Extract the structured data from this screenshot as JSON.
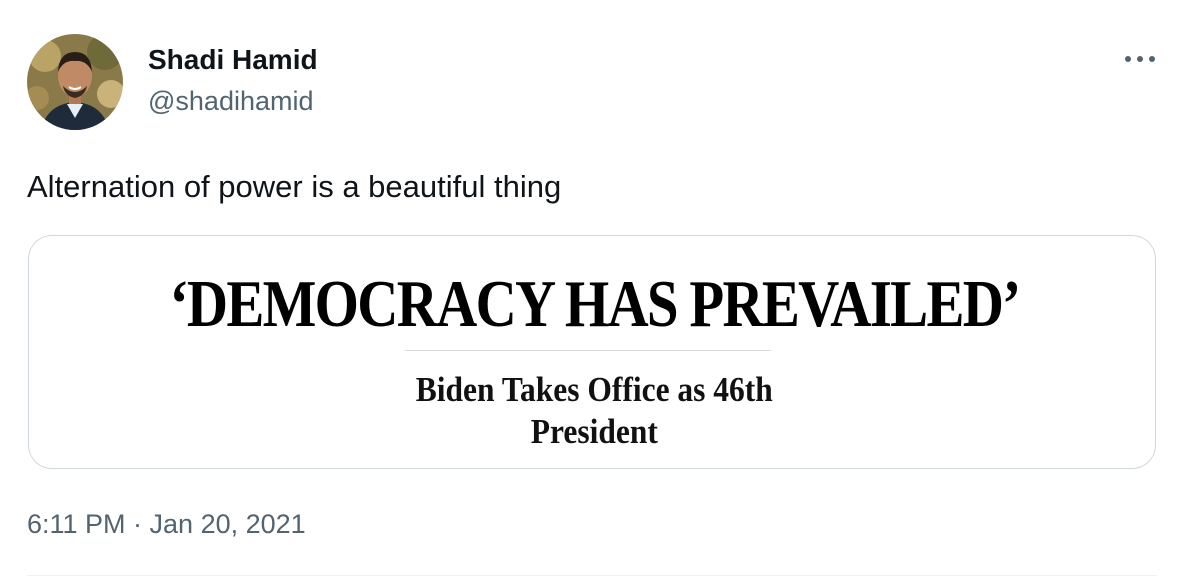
{
  "author": {
    "display_name": "Shadi Hamid",
    "handle": "@shadihamid",
    "avatar_icon": "person-portrait-icon"
  },
  "tweet": {
    "text": "Alternation of power is a beautiful thing",
    "timestamp": "6:11 PM · Jan 20, 2021"
  },
  "media": {
    "headline": "‘DEMOCRACY HAS PREVAILED’",
    "subhead_line1": "Biden Takes Office as 46th",
    "subhead_line2": "President"
  },
  "more_icon": "more-horizontal-icon",
  "colors": {
    "text_primary": "#0f1419",
    "text_secondary": "#536471",
    "card_border": "#cfd9de"
  }
}
